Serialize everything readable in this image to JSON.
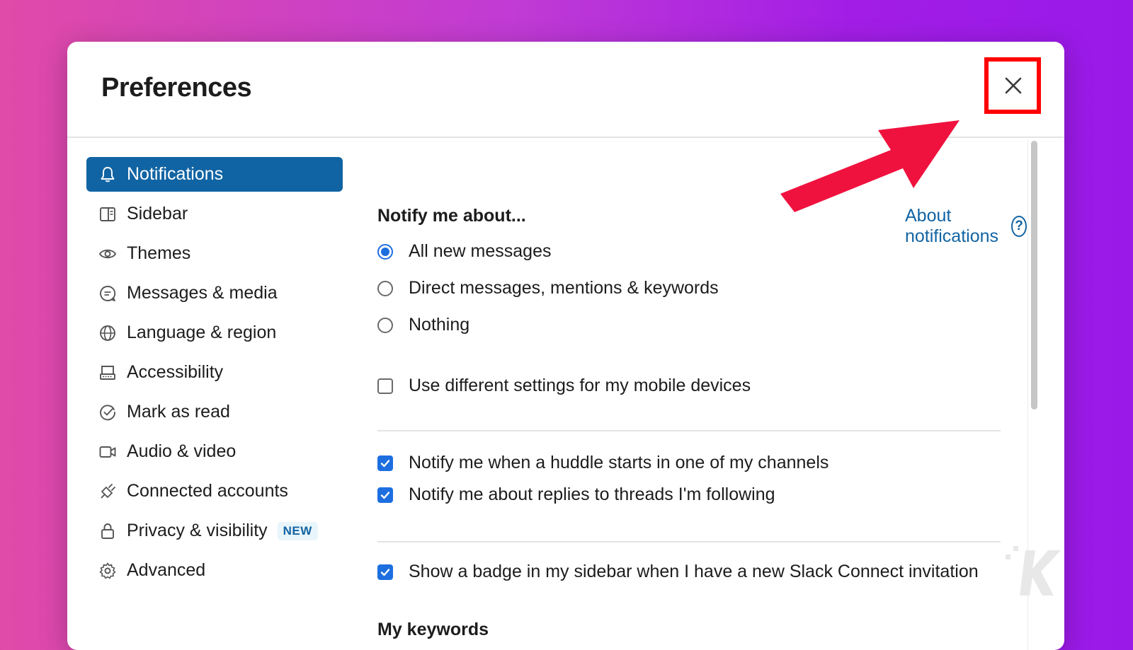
{
  "modal": {
    "title": "Preferences",
    "close_icon": "close-icon"
  },
  "sidebar": {
    "items": [
      {
        "label": "Notifications",
        "icon": "bell-icon",
        "active": true
      },
      {
        "label": "Sidebar",
        "icon": "sidebar-icon"
      },
      {
        "label": "Themes",
        "icon": "eye-icon"
      },
      {
        "label": "Messages & media",
        "icon": "message-icon"
      },
      {
        "label": "Language & region",
        "icon": "globe-icon"
      },
      {
        "label": "Accessibility",
        "icon": "keyboard-icon"
      },
      {
        "label": "Mark as read",
        "icon": "check-circle-icon"
      },
      {
        "label": "Audio & video",
        "icon": "video-icon"
      },
      {
        "label": "Connected accounts",
        "icon": "plug-icon"
      },
      {
        "label": "Privacy & visibility",
        "icon": "lock-icon",
        "badge": "NEW"
      },
      {
        "label": "Advanced",
        "icon": "gear-icon"
      }
    ]
  },
  "content": {
    "notify_heading": "Notify me about...",
    "about_link": "About notifications",
    "notify_options": [
      {
        "label": "All new messages",
        "selected": true
      },
      {
        "label": "Direct messages, mentions & keywords",
        "selected": false
      },
      {
        "label": "Nothing",
        "selected": false
      }
    ],
    "mobile_setting": {
      "label": "Use different settings for my mobile devices",
      "checked": false
    },
    "huddle_setting": {
      "label": "Notify me when a huddle starts in one of my channels",
      "checked": true
    },
    "threads_setting": {
      "label": "Notify me about replies to threads I'm following",
      "checked": true
    },
    "badge_setting": {
      "label": "Show a badge in my sidebar when I have a new Slack Connect invitation",
      "checked": true
    },
    "keywords_heading": "My keywords"
  },
  "colors": {
    "active_nav": "#1164a3",
    "accent": "#1d6fe0",
    "link": "#1264a3",
    "highlight": "#ff0000",
    "arrow": "#f0123e"
  }
}
